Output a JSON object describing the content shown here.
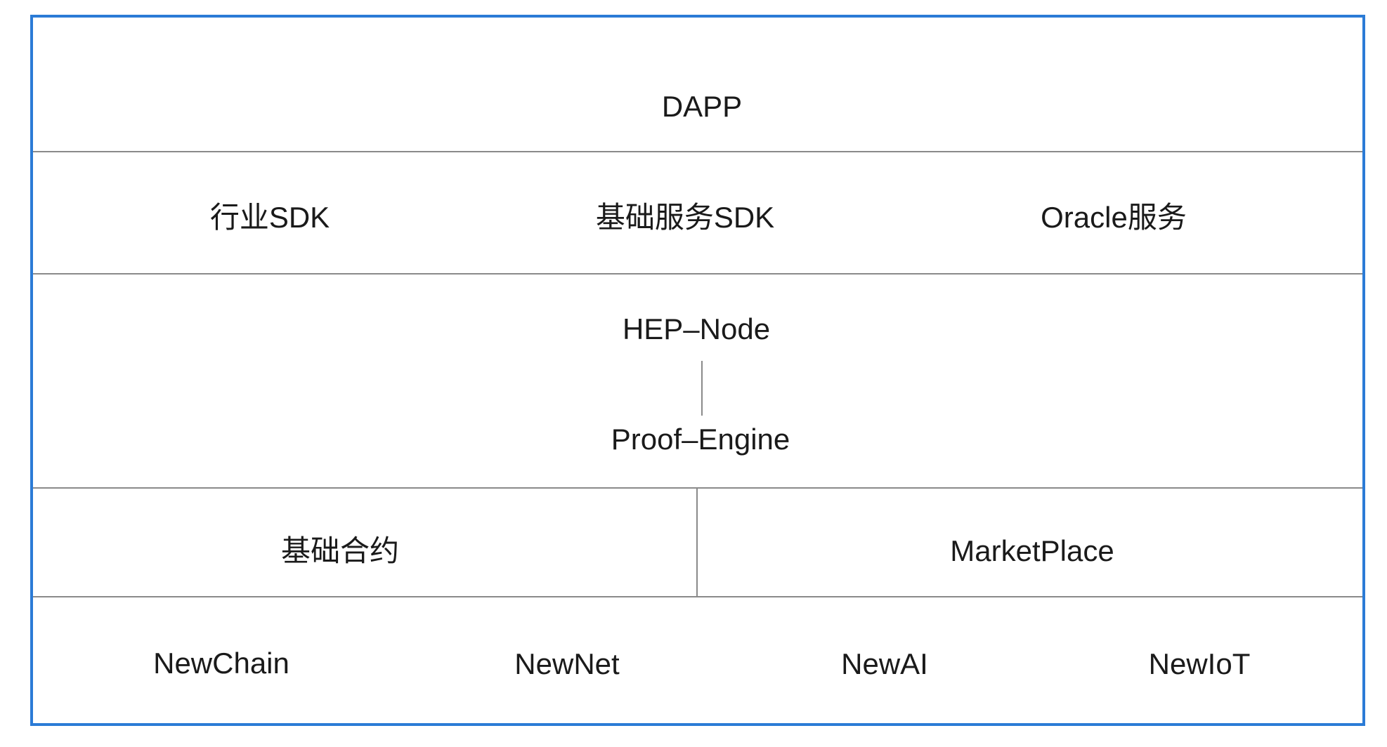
{
  "layers": {
    "top": "DAPP",
    "sdk": [
      "行业SDK",
      "基础服务SDK",
      "Oracle服务"
    ],
    "node": {
      "upper": "HEP–Node",
      "lower": "Proof–Engine"
    },
    "contracts": [
      "基础合约",
      "MarketPlace"
    ],
    "base": [
      "NewChain",
      "NewNet",
      "NewAI",
      "NewIoT"
    ]
  },
  "colors": {
    "frame": "#2b7bd6",
    "divider": "#8a8a8a"
  }
}
